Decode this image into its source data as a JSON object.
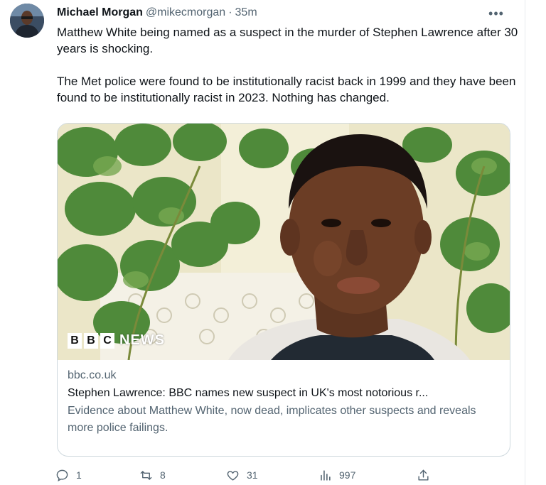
{
  "tweet": {
    "author_name": "Michael Morgan",
    "handle": "@mikecmorgan",
    "separator": "·",
    "time": "35m",
    "more_label": "•••",
    "text_paragraphs": [
      "Matthew White being named as a suspect in the murder of Stephen Lawrence after 30 years is shocking.",
      "The Met police were found to be institutionally racist back in 1999 and they have been found to be institutionally racist in 2023. Nothing has changed."
    ]
  },
  "card": {
    "image_logo": {
      "b1": "B",
      "b2": "B",
      "b3": "C",
      "news": "NEWS"
    },
    "domain": "bbc.co.uk",
    "title": "Stephen Lawrence: BBC names new suspect in UK's most notorious r...",
    "description": "Evidence about Matthew White, now dead, implicates other suspects and reveals more police failings."
  },
  "actions": {
    "reply_count": "1",
    "retweet_count": "8",
    "like_count": "31",
    "views_count": "997"
  },
  "icons": {
    "reply": "reply-icon",
    "retweet": "retweet-icon",
    "like": "heart-icon",
    "views": "views-icon",
    "share": "share-icon",
    "more": "more-icon"
  },
  "colors": {
    "text_primary": "#0f1419",
    "text_secondary": "#536471",
    "border": "#cfd9de"
  }
}
